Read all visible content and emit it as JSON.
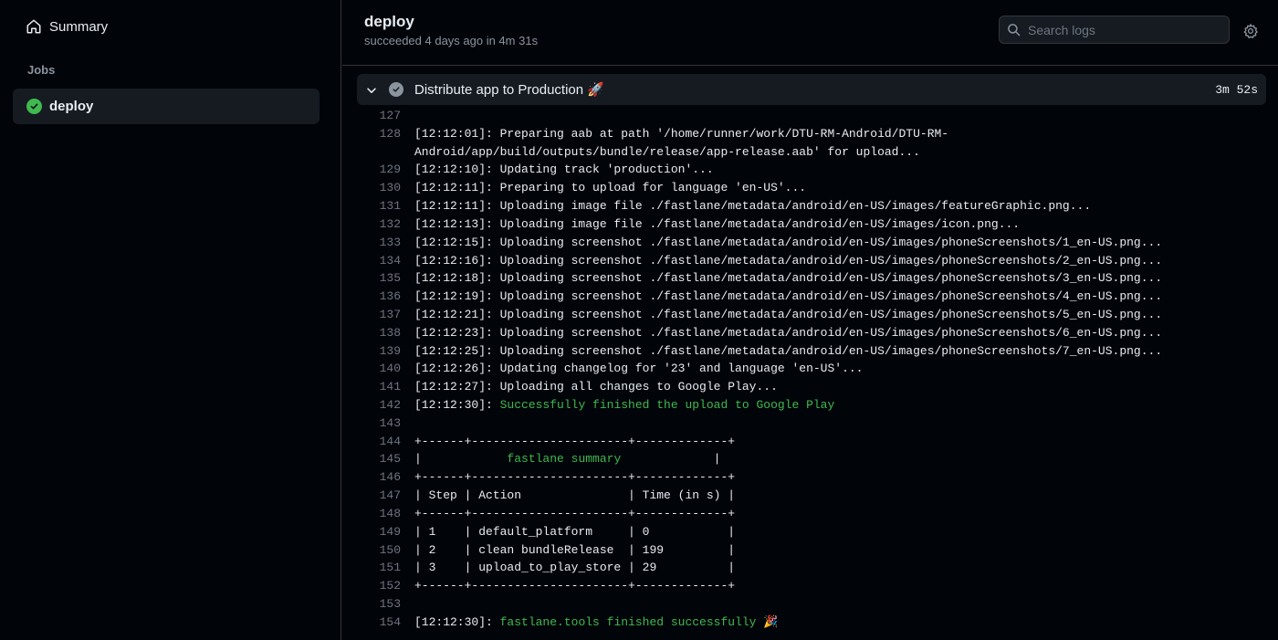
{
  "sidebar": {
    "summary_label": "Summary",
    "jobs_heading": "Jobs",
    "job": {
      "label": "deploy",
      "status": "success"
    }
  },
  "header": {
    "title": "deploy",
    "subtitle": "succeeded 4 days ago in 4m 31s",
    "search_placeholder": "Search logs"
  },
  "step": {
    "name": "Distribute app to Production 🚀",
    "duration": "3m 52s",
    "expanded": true
  },
  "log": {
    "lines": [
      {
        "num": "127",
        "text": "",
        "ok": ""
      },
      {
        "num": "128",
        "text": "[12:12:01]: Preparing aab at path '/home/runner/work/DTU-RM-Android/DTU-RM-Android/app/build/outputs/bundle/release/app-release.aab' for upload...",
        "ok": ""
      },
      {
        "num": "129",
        "text": "[12:12:10]: Updating track 'production'...",
        "ok": ""
      },
      {
        "num": "130",
        "text": "[12:12:11]: Preparing to upload for language 'en-US'...",
        "ok": ""
      },
      {
        "num": "131",
        "text": "[12:12:11]: Uploading image file ./fastlane/metadata/android/en-US/images/featureGraphic.png...",
        "ok": ""
      },
      {
        "num": "132",
        "text": "[12:12:13]: Uploading image file ./fastlane/metadata/android/en-US/images/icon.png...",
        "ok": ""
      },
      {
        "num": "133",
        "text": "[12:12:15]: Uploading screenshot ./fastlane/metadata/android/en-US/images/phoneScreenshots/1_en-US.png...",
        "ok": ""
      },
      {
        "num": "134",
        "text": "[12:12:16]: Uploading screenshot ./fastlane/metadata/android/en-US/images/phoneScreenshots/2_en-US.png...",
        "ok": ""
      },
      {
        "num": "135",
        "text": "[12:12:18]: Uploading screenshot ./fastlane/metadata/android/en-US/images/phoneScreenshots/3_en-US.png...",
        "ok": ""
      },
      {
        "num": "136",
        "text": "[12:12:19]: Uploading screenshot ./fastlane/metadata/android/en-US/images/phoneScreenshots/4_en-US.png...",
        "ok": ""
      },
      {
        "num": "137",
        "text": "[12:12:21]: Uploading screenshot ./fastlane/metadata/android/en-US/images/phoneScreenshots/5_en-US.png...",
        "ok": ""
      },
      {
        "num": "138",
        "text": "[12:12:23]: Uploading screenshot ./fastlane/metadata/android/en-US/images/phoneScreenshots/6_en-US.png...",
        "ok": ""
      },
      {
        "num": "139",
        "text": "[12:12:25]: Uploading screenshot ./fastlane/metadata/android/en-US/images/phoneScreenshots/7_en-US.png...",
        "ok": ""
      },
      {
        "num": "140",
        "text": "[12:12:26]: Updating changelog for '23' and language 'en-US'...",
        "ok": ""
      },
      {
        "num": "141",
        "text": "[12:12:27]: Uploading all changes to Google Play...",
        "ok": ""
      },
      {
        "num": "142",
        "text": "[12:12:30]: ",
        "ok": "Successfully finished the upload to Google Play"
      },
      {
        "num": "143",
        "text": "",
        "ok": ""
      },
      {
        "num": "144",
        "text": "+------+----------------------+-------------+",
        "ok": ""
      },
      {
        "num": "145",
        "text": "|",
        "ok": "            fastlane summary             ",
        "tail": "|"
      },
      {
        "num": "146",
        "text": "+------+----------------------+-------------+",
        "ok": ""
      },
      {
        "num": "147",
        "text": "| Step | Action               | Time (in s) |",
        "ok": ""
      },
      {
        "num": "148",
        "text": "+------+----------------------+-------------+",
        "ok": ""
      },
      {
        "num": "149",
        "text": "| 1    | default_platform     | 0           |",
        "ok": ""
      },
      {
        "num": "150",
        "text": "| 2    | clean bundleRelease  | 199         |",
        "ok": ""
      },
      {
        "num": "151",
        "text": "| 3    | upload_to_play_store | 29          |",
        "ok": ""
      },
      {
        "num": "152",
        "text": "+------+----------------------+-------------+",
        "ok": ""
      },
      {
        "num": "153",
        "text": "",
        "ok": ""
      },
      {
        "num": "154",
        "text": "[12:12:30]: ",
        "ok": "fastlane.tools finished successfully 🎉"
      }
    ]
  },
  "colors": {
    "background": "#010409",
    "panel": "#161b22",
    "success": "#3fb950",
    "muted": "#8b949e"
  },
  "icons": [
    "home-icon",
    "check-circle-icon",
    "search-icon",
    "gear-icon",
    "chevron-down-icon",
    "step-done-icon"
  ]
}
